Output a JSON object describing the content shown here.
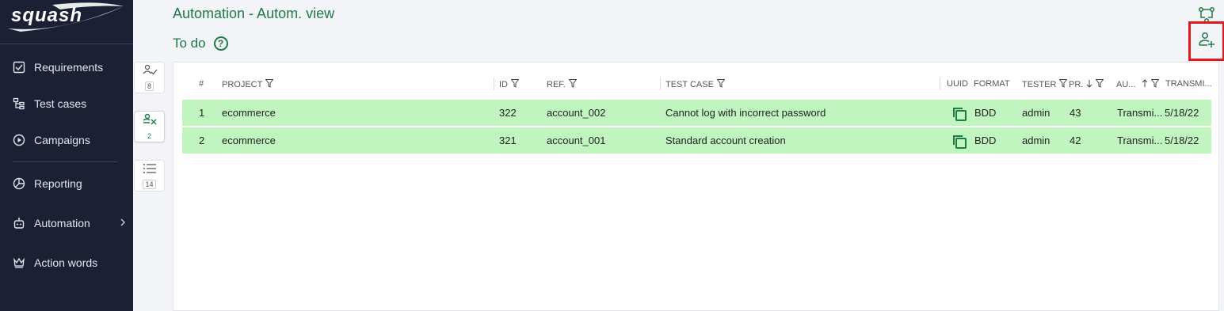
{
  "app": {
    "logo": "squash",
    "title": "Automation - Autom. view",
    "subtitle": "To do",
    "help_glyph": "?",
    "help_icon": "question-circle-icon",
    "accent_color": "#1e7a46",
    "row_color": "#c0f5c0"
  },
  "sidebar": {
    "items": [
      {
        "label": "Requirements",
        "icon": "checkbox-icon"
      },
      {
        "label": "Test cases",
        "icon": "tree-icon"
      },
      {
        "label": "Campaigns",
        "icon": "play-circle-icon"
      },
      {
        "label": "Reporting",
        "icon": "pie-chart-icon"
      },
      {
        "label": "Automation",
        "icon": "robot-icon"
      },
      {
        "label": "Action words",
        "icon": "crown-icon"
      }
    ]
  },
  "side_tabs": [
    {
      "count": "8",
      "icon": "user-check-icon"
    },
    {
      "count": "2",
      "icon": "user-x-icon"
    },
    {
      "count": "14",
      "icon": "list-icon"
    }
  ],
  "table": {
    "headers": {
      "num": "#",
      "project": "PROJECT",
      "id": "ID",
      "ref": "REF.",
      "test_case": "TEST CASE",
      "uuid": "UUID",
      "format": "FORMAT",
      "tester": "TESTER",
      "priority": "PR.",
      "automation": "AU...",
      "transmitted": "TRANSMI..."
    },
    "rows": [
      {
        "num": "1",
        "project": "ecommerce",
        "id": "322",
        "ref": "account_002",
        "test_case": "Cannot log with incorrect password",
        "format": "BDD",
        "tester": "admin",
        "priority": "43",
        "status": "Transmi...",
        "date": "5/18/22"
      },
      {
        "num": "2",
        "project": "ecommerce",
        "id": "321",
        "ref": "account_001",
        "test_case": "Standard account creation",
        "format": "BDD",
        "tester": "admin",
        "priority": "42",
        "status": "Transmi...",
        "date": "5/18/22"
      }
    ]
  }
}
